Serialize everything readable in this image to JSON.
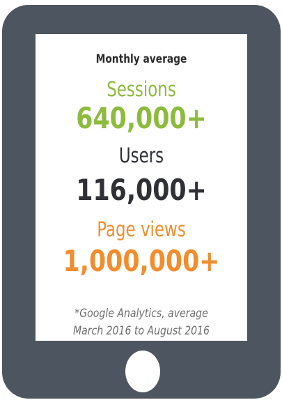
{
  "heading": "Monthly average",
  "metrics": [
    {
      "label": "Sessions",
      "value": "640,000+",
      "color": "#8cbb3e"
    },
    {
      "label": "Users",
      "value": "116,000+",
      "color": "#2f3136"
    },
    {
      "label": "Page views",
      "value": "1,000,000+",
      "color": "#f28d2e"
    }
  ],
  "footnote": {
    "line1": "*Google Analytics, average",
    "line2": "March 2016 to August 2016"
  }
}
